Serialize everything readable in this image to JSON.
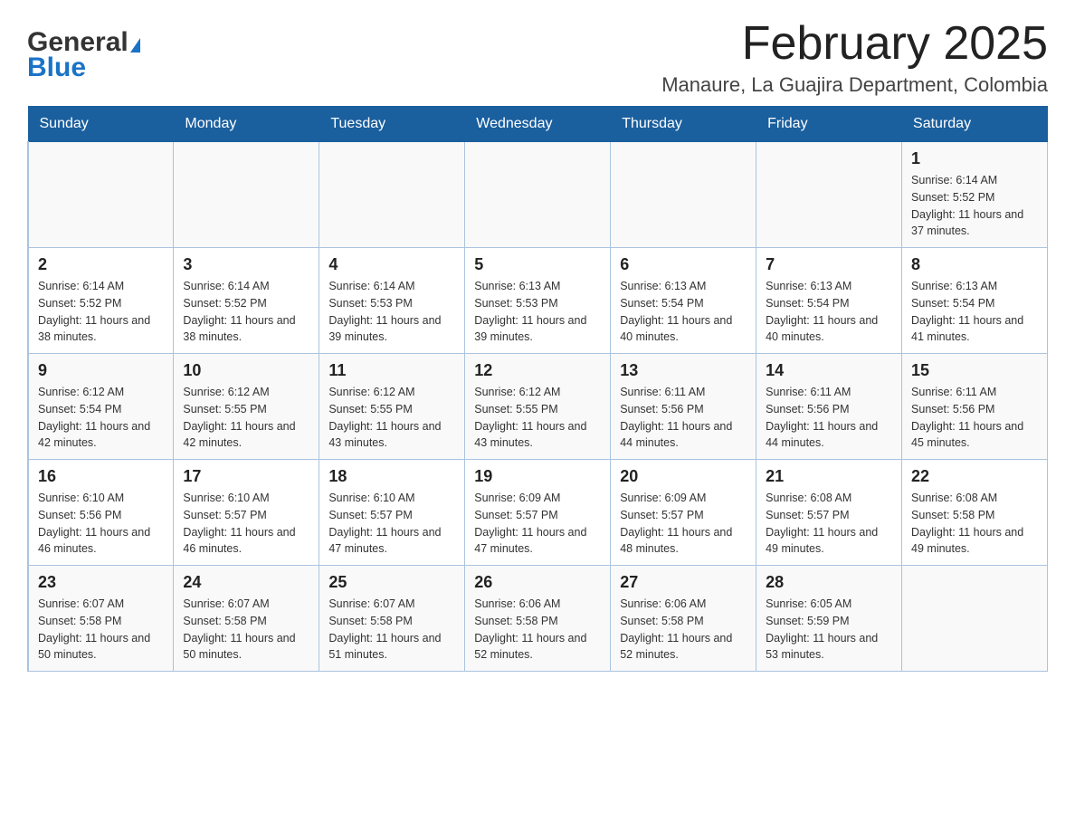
{
  "header": {
    "logo_general": "General",
    "logo_blue": "Blue",
    "month_title": "February 2025",
    "location": "Manaure, La Guajira Department, Colombia"
  },
  "weekdays": [
    "Sunday",
    "Monday",
    "Tuesday",
    "Wednesday",
    "Thursday",
    "Friday",
    "Saturday"
  ],
  "weeks": [
    [
      {
        "day": "",
        "info": ""
      },
      {
        "day": "",
        "info": ""
      },
      {
        "day": "",
        "info": ""
      },
      {
        "day": "",
        "info": ""
      },
      {
        "day": "",
        "info": ""
      },
      {
        "day": "",
        "info": ""
      },
      {
        "day": "1",
        "info": "Sunrise: 6:14 AM\nSunset: 5:52 PM\nDaylight: 11 hours and 37 minutes."
      }
    ],
    [
      {
        "day": "2",
        "info": "Sunrise: 6:14 AM\nSunset: 5:52 PM\nDaylight: 11 hours and 38 minutes."
      },
      {
        "day": "3",
        "info": "Sunrise: 6:14 AM\nSunset: 5:52 PM\nDaylight: 11 hours and 38 minutes."
      },
      {
        "day": "4",
        "info": "Sunrise: 6:14 AM\nSunset: 5:53 PM\nDaylight: 11 hours and 39 minutes."
      },
      {
        "day": "5",
        "info": "Sunrise: 6:13 AM\nSunset: 5:53 PM\nDaylight: 11 hours and 39 minutes."
      },
      {
        "day": "6",
        "info": "Sunrise: 6:13 AM\nSunset: 5:54 PM\nDaylight: 11 hours and 40 minutes."
      },
      {
        "day": "7",
        "info": "Sunrise: 6:13 AM\nSunset: 5:54 PM\nDaylight: 11 hours and 40 minutes."
      },
      {
        "day": "8",
        "info": "Sunrise: 6:13 AM\nSunset: 5:54 PM\nDaylight: 11 hours and 41 minutes."
      }
    ],
    [
      {
        "day": "9",
        "info": "Sunrise: 6:12 AM\nSunset: 5:54 PM\nDaylight: 11 hours and 42 minutes."
      },
      {
        "day": "10",
        "info": "Sunrise: 6:12 AM\nSunset: 5:55 PM\nDaylight: 11 hours and 42 minutes."
      },
      {
        "day": "11",
        "info": "Sunrise: 6:12 AM\nSunset: 5:55 PM\nDaylight: 11 hours and 43 minutes."
      },
      {
        "day": "12",
        "info": "Sunrise: 6:12 AM\nSunset: 5:55 PM\nDaylight: 11 hours and 43 minutes."
      },
      {
        "day": "13",
        "info": "Sunrise: 6:11 AM\nSunset: 5:56 PM\nDaylight: 11 hours and 44 minutes."
      },
      {
        "day": "14",
        "info": "Sunrise: 6:11 AM\nSunset: 5:56 PM\nDaylight: 11 hours and 44 minutes."
      },
      {
        "day": "15",
        "info": "Sunrise: 6:11 AM\nSunset: 5:56 PM\nDaylight: 11 hours and 45 minutes."
      }
    ],
    [
      {
        "day": "16",
        "info": "Sunrise: 6:10 AM\nSunset: 5:56 PM\nDaylight: 11 hours and 46 minutes."
      },
      {
        "day": "17",
        "info": "Sunrise: 6:10 AM\nSunset: 5:57 PM\nDaylight: 11 hours and 46 minutes."
      },
      {
        "day": "18",
        "info": "Sunrise: 6:10 AM\nSunset: 5:57 PM\nDaylight: 11 hours and 47 minutes."
      },
      {
        "day": "19",
        "info": "Sunrise: 6:09 AM\nSunset: 5:57 PM\nDaylight: 11 hours and 47 minutes."
      },
      {
        "day": "20",
        "info": "Sunrise: 6:09 AM\nSunset: 5:57 PM\nDaylight: 11 hours and 48 minutes."
      },
      {
        "day": "21",
        "info": "Sunrise: 6:08 AM\nSunset: 5:57 PM\nDaylight: 11 hours and 49 minutes."
      },
      {
        "day": "22",
        "info": "Sunrise: 6:08 AM\nSunset: 5:58 PM\nDaylight: 11 hours and 49 minutes."
      }
    ],
    [
      {
        "day": "23",
        "info": "Sunrise: 6:07 AM\nSunset: 5:58 PM\nDaylight: 11 hours and 50 minutes."
      },
      {
        "day": "24",
        "info": "Sunrise: 6:07 AM\nSunset: 5:58 PM\nDaylight: 11 hours and 50 minutes."
      },
      {
        "day": "25",
        "info": "Sunrise: 6:07 AM\nSunset: 5:58 PM\nDaylight: 11 hours and 51 minutes."
      },
      {
        "day": "26",
        "info": "Sunrise: 6:06 AM\nSunset: 5:58 PM\nDaylight: 11 hours and 52 minutes."
      },
      {
        "day": "27",
        "info": "Sunrise: 6:06 AM\nSunset: 5:58 PM\nDaylight: 11 hours and 52 minutes."
      },
      {
        "day": "28",
        "info": "Sunrise: 6:05 AM\nSunset: 5:59 PM\nDaylight: 11 hours and 53 minutes."
      },
      {
        "day": "",
        "info": ""
      }
    ]
  ]
}
